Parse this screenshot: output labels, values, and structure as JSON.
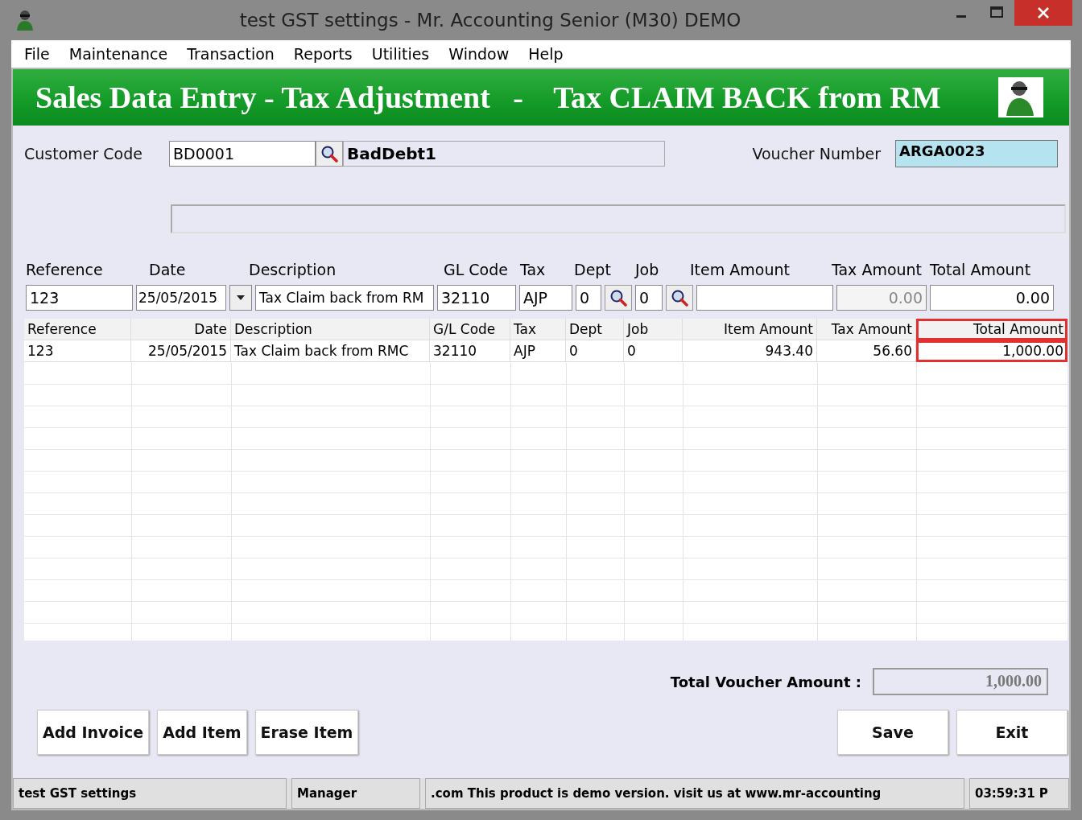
{
  "window": {
    "title": "test GST settings - Mr. Accounting Senior (M30) DEMO"
  },
  "menu": [
    "File",
    "Maintenance",
    "Transaction",
    "Reports",
    "Utilities",
    "Window",
    "Help"
  ],
  "banner": {
    "title": "Sales Data Entry - Tax Adjustment   -    Tax CLAIM BACK from RM"
  },
  "customer": {
    "label": "Customer Code",
    "code": "BD0001",
    "name": "BadDebt1"
  },
  "voucher": {
    "label": "Voucher Number",
    "value": "ARGA0023"
  },
  "entry": {
    "labels": [
      "Reference",
      "Date",
      "Description",
      "GL Code",
      "Tax",
      "Dept",
      "Job",
      "Item Amount",
      "Tax Amount",
      "Total Amount"
    ],
    "reference": "123",
    "date": "25/05/2015",
    "description": "Tax Claim back from RM",
    "gl_code": "32110",
    "tax": "AJP",
    "dept": "0",
    "job": "0",
    "tax_amount": "0.00",
    "total_amount": "0.00"
  },
  "table": {
    "columns": [
      {
        "label": "Reference",
        "highlighted": false
      },
      {
        "label": "Date",
        "highlighted": false
      },
      {
        "label": "Description",
        "highlighted": false
      },
      {
        "label": "G/L Code",
        "highlighted": false
      },
      {
        "label": "Tax",
        "highlighted": false
      },
      {
        "label": "Dept",
        "highlighted": false
      },
      {
        "label": "Job",
        "highlighted": false
      },
      {
        "label": "Item Amount",
        "highlighted": false
      },
      {
        "label": "Tax Amount",
        "highlighted": false
      },
      {
        "label": "Total Amount",
        "highlighted": true
      }
    ],
    "rows": [
      [
        "123",
        "25/05/2015",
        "Tax Claim back from RMC",
        "32110",
        "AJP",
        "0",
        "0",
        "943.40",
        "56.60",
        "1,000.00"
      ]
    ]
  },
  "total": {
    "label": "Total  Voucher Amount :",
    "value": "1,000.00"
  },
  "left_buttons": [
    "Add Invoice",
    "Add Item",
    "Erase Item"
  ],
  "right_buttons": [
    "Save",
    "Exit"
  ],
  "status_bar": [
    "test GST settings",
    "Manager",
    ".com This product is demo version.  visit us at www.mr-accounting",
    "03:59:31 P"
  ]
}
